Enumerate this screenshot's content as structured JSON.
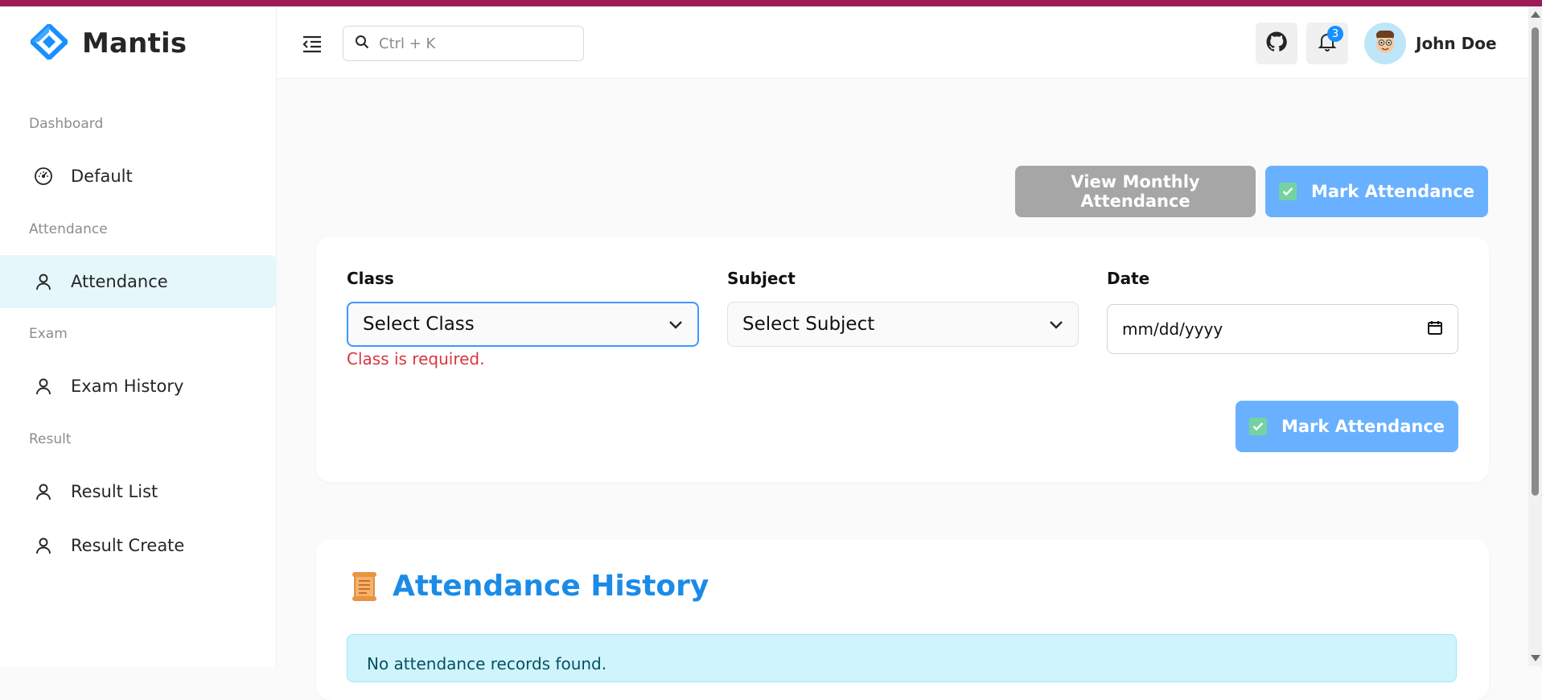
{
  "brand": {
    "name": "Mantis",
    "accent_color": "#9e1c54",
    "logo_color": "#1890ff"
  },
  "sidebar": {
    "groups": [
      {
        "label": "Dashboard",
        "items": [
          {
            "label": "Default",
            "icon": "dashboard-gauge-icon"
          }
        ]
      },
      {
        "label": "Attendance",
        "items": [
          {
            "label": "Attendance",
            "icon": "user-icon",
            "active": true
          }
        ]
      },
      {
        "label": "Exam",
        "items": [
          {
            "label": "Exam History",
            "icon": "user-icon"
          }
        ]
      },
      {
        "label": "Result",
        "items": [
          {
            "label": "Result List",
            "icon": "user-icon"
          },
          {
            "label": "Result Create",
            "icon": "user-icon"
          }
        ]
      }
    ]
  },
  "header": {
    "search_placeholder": "Ctrl + K",
    "notification_count": "3",
    "user_name": "John Doe",
    "icons": [
      "menu-collapse-icon",
      "search-icon",
      "github-icon",
      "bell-icon",
      "avatar"
    ]
  },
  "actions": {
    "view_monthly_label": "View Monthly Attendance",
    "mark_attendance_label": "Mark Attendance"
  },
  "form": {
    "class_label": "Class",
    "class_value": "Select Class",
    "class_error": "Class is required.",
    "subject_label": "Subject",
    "subject_value": "Select Subject",
    "date_label": "Date",
    "date_value": "mm/dd/yyyy",
    "submit_label": "Mark Attendance"
  },
  "history": {
    "title_icon": "scroll-icon",
    "title": "Attendance History",
    "empty_message": "No attendance records found."
  },
  "colors": {
    "primary": "#1890ff",
    "button_blue": "#69b1ff",
    "button_grey": "#a6a6a6",
    "error": "#d9363e",
    "active_bg": "#e6f7fb",
    "alert_bg": "#cff4fc"
  }
}
